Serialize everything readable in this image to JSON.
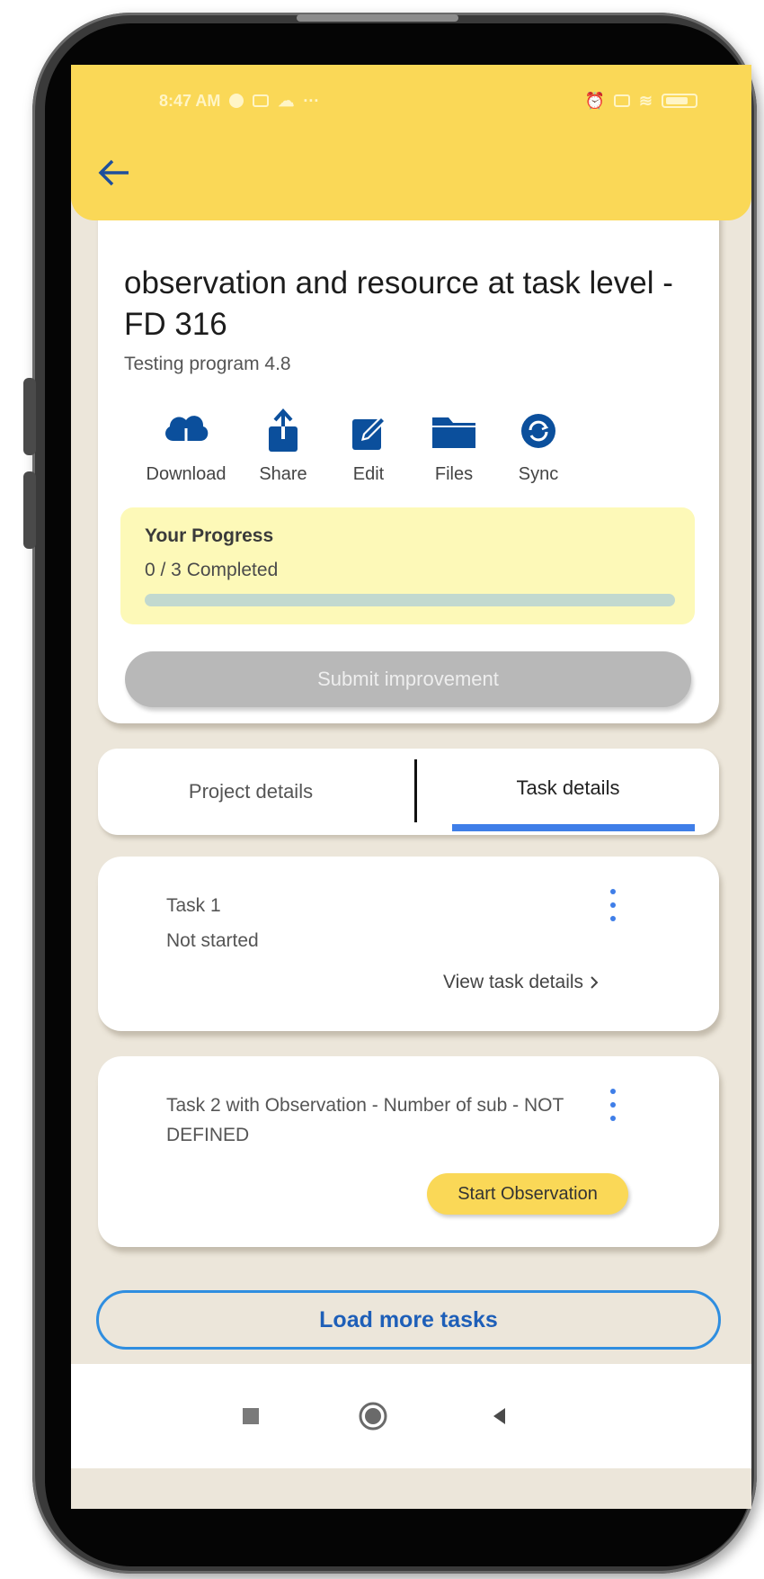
{
  "status_bar": {
    "time": "8:47 AM",
    "icons_left": [
      "notification-icon",
      "mail-icon",
      "cloud-icon",
      "more-dots-icon"
    ],
    "icons_right": [
      "alarm-icon",
      "signal-icon",
      "wifi-icon",
      "battery-icon"
    ]
  },
  "header": {
    "back_icon": "arrow-left-icon"
  },
  "project": {
    "title": "observation and resource at task level - FD 316",
    "program": "Testing program 4.8",
    "actions": [
      {
        "label": "Download",
        "icon": "cloud-download-icon"
      },
      {
        "label": "Share",
        "icon": "share-icon"
      },
      {
        "label": "Edit",
        "icon": "edit-icon"
      },
      {
        "label": "Files",
        "icon": "folder-icon"
      },
      {
        "label": "Sync",
        "icon": "sync-icon"
      }
    ],
    "progress": {
      "title": "Your Progress",
      "completed_text": "0 / 3 Completed",
      "fraction": 0
    },
    "submit_label": "Submit improvement"
  },
  "tabs": {
    "project_details": "Project details",
    "task_details": "Task details",
    "active": "Task details"
  },
  "tasks": [
    {
      "name": "Task 1",
      "status": "Not started",
      "link_label": "View task details",
      "link_icon": "chevron-right-icon"
    },
    {
      "name": "Task 2 with Observation - Number of sub - NOT DEFINED",
      "action_label": "Start Observation"
    }
  ],
  "load_more_label": "Load more tasks",
  "nav_bar": {
    "buttons": [
      "recents-square-icon",
      "home-circle-icon",
      "back-triangle-icon"
    ]
  },
  "colors": {
    "header_yellow": "#fad857",
    "screen_background": "#ece6da",
    "action_icon_blue": "#0b4f9c",
    "progress_box": "#fdf9b8",
    "progress_track": "#c2d9cf",
    "tab_underline": "#3f7ee8",
    "submit_disabled": "#b8b8b8",
    "load_more_border": "#2f8ee0"
  }
}
